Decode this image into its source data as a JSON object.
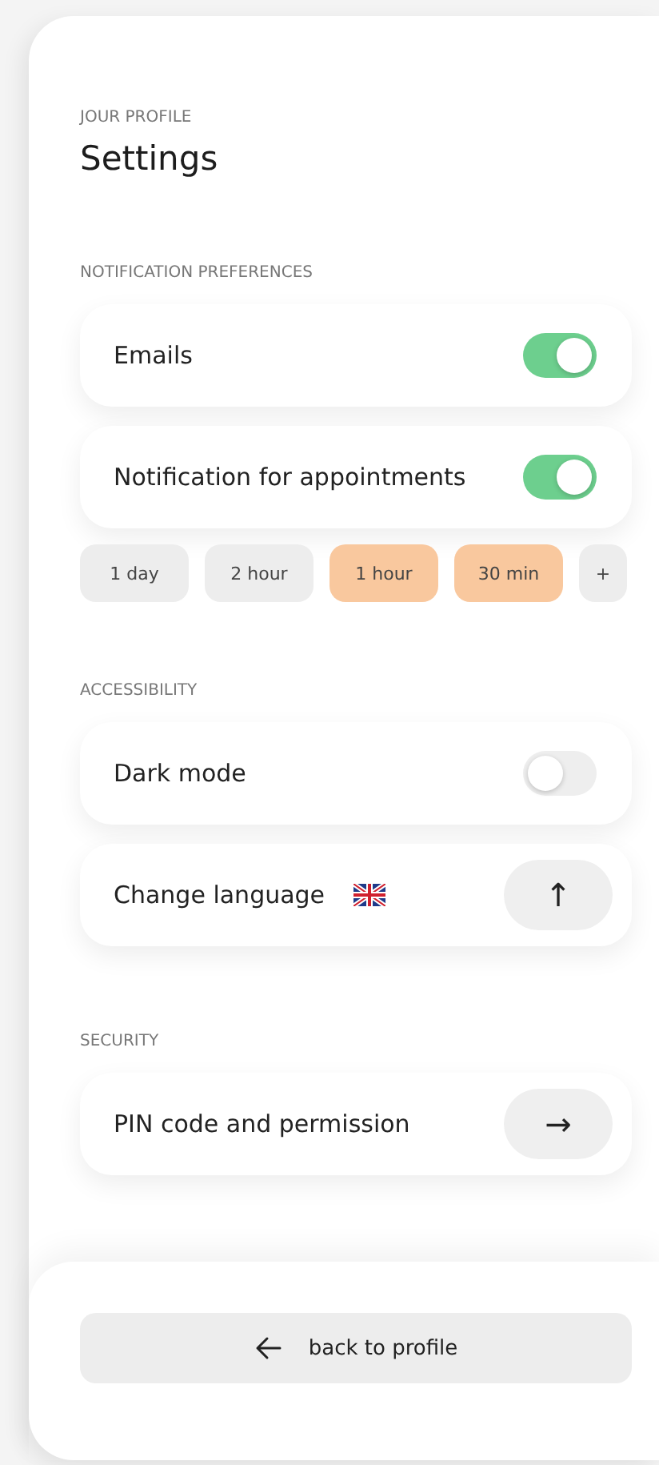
{
  "header": {
    "eyebrow": "JOUR PROFILE",
    "title": "Settings"
  },
  "sections": [
    {
      "heading": "NOTIFICATION PREFERENCES",
      "rows": [
        {
          "kind": "toggle",
          "label": "Emails",
          "on": true
        },
        {
          "kind": "toggle",
          "label": "Notification for appointments",
          "on": true
        }
      ],
      "chips": [
        {
          "label": "1 day",
          "selected": false
        },
        {
          "label": "2 hour",
          "selected": false
        },
        {
          "label": "1 hour",
          "selected": true
        },
        {
          "label": "30 min",
          "selected": true
        },
        {
          "label": "+",
          "selected": false
        }
      ]
    },
    {
      "heading": "ACCESSIBILITY",
      "rows": [
        {
          "kind": "toggle",
          "label": "Dark mode",
          "on": false
        },
        {
          "kind": "arrow",
          "label": "Change language",
          "flag": true,
          "button": "↑"
        }
      ]
    },
    {
      "heading": "SECURITY",
      "rows": [
        {
          "kind": "arrow",
          "label": "PIN code and permission",
          "button": "→"
        }
      ]
    }
  ],
  "footer": {
    "button": "back to profile"
  }
}
